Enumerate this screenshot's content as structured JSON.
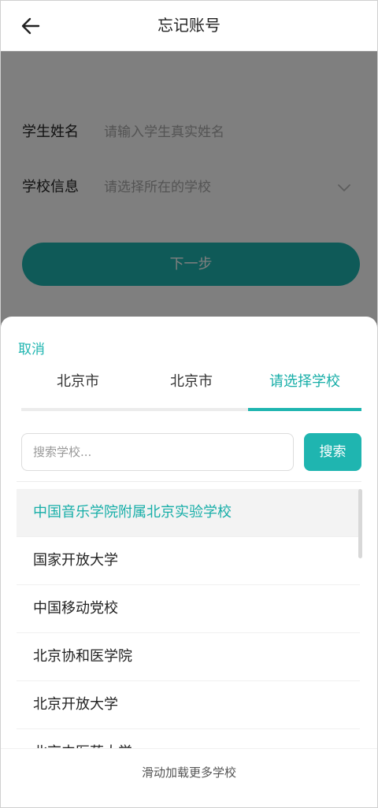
{
  "header": {
    "title": "忘记账号"
  },
  "form": {
    "student_name_label": "学生姓名",
    "student_name_placeholder": "请输入学生真实姓名",
    "school_label": "学校信息",
    "school_placeholder": "请选择所在的学校",
    "next_label": "下一步"
  },
  "sheet": {
    "cancel_label": "取消",
    "tabs": [
      {
        "label": "北京市",
        "active": false
      },
      {
        "label": "北京市",
        "active": false
      },
      {
        "label": "请选择学校",
        "active": true
      }
    ],
    "search_placeholder": "搜索学校...",
    "search_button": "搜索",
    "schools": [
      "中国音乐学院附属北京实验学校",
      "国家开放大学",
      "中国移动党校",
      "北京协和医学院",
      "北京开放大学",
      "北京中医药大学"
    ],
    "selected_index": 0,
    "load_more": "滑动加载更多学校"
  },
  "colors": {
    "accent": "#1fb5b0",
    "overlay": "rgba(0,0,0,0.5)"
  }
}
